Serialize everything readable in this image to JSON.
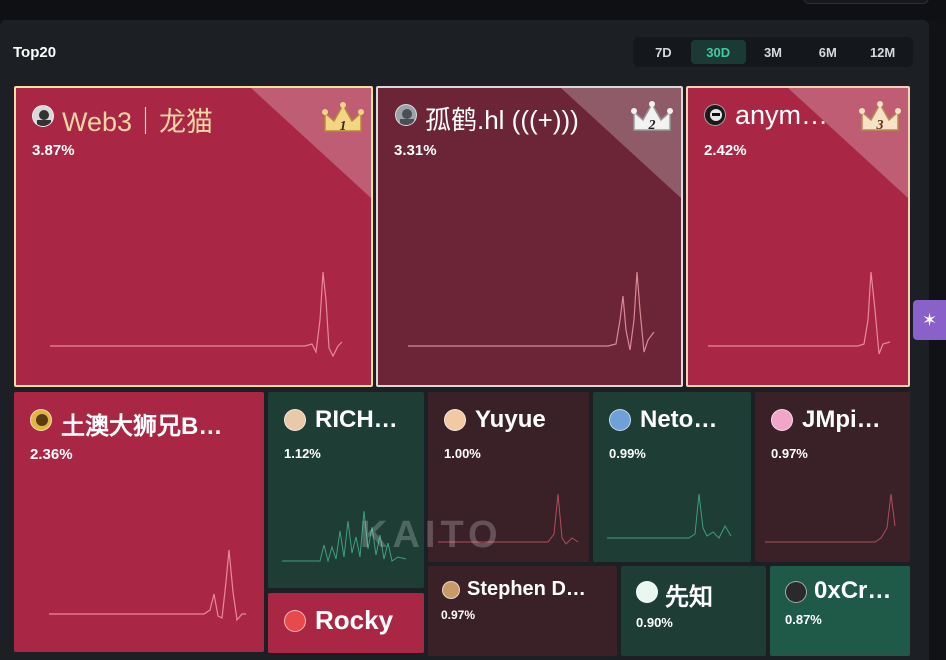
{
  "section_title": "Top20",
  "periods": [
    {
      "label": "7D",
      "active": false
    },
    {
      "label": "30D",
      "active": true
    },
    {
      "label": "3M",
      "active": false
    },
    {
      "label": "6M",
      "active": false
    },
    {
      "label": "12M",
      "active": false
    }
  ],
  "colors": {
    "red_tile": "#a92744",
    "dark_red_tile": "#6b2536",
    "maroon_tile": "#3a2128",
    "green_tile": "#1d3d35",
    "accent_green": "#3ecba4",
    "gold_border": "#f3e0a0"
  },
  "tiles": [
    {
      "rank": "1",
      "name": "Web3｜龙猫",
      "percent": "3.87%",
      "avatar_icon": "avatar-icon"
    },
    {
      "rank": "2",
      "name": "孤鹤.hl (((+)))",
      "percent": "3.31%",
      "avatar_icon": "avatar-icon"
    },
    {
      "rank": "3",
      "name": "anym…",
      "percent": "2.42%",
      "avatar_icon": "avatar-icon"
    },
    {
      "name": "土澳大狮兄B…",
      "percent": "2.36%"
    },
    {
      "name": "RICH…",
      "percent": "1.12%"
    },
    {
      "name": "Yuyue",
      "percent": "1.00%"
    },
    {
      "name": "Neto…",
      "percent": "0.99%"
    },
    {
      "name": "JMpi…",
      "percent": "0.97%"
    },
    {
      "name": "Stephen D…",
      "percent": "0.97%"
    },
    {
      "name": "先知",
      "percent": "0.90%"
    },
    {
      "name": "0xCr…",
      "percent": "0.87%"
    },
    {
      "name": "Rocky",
      "percent": ""
    }
  ],
  "watermark": "KAITO",
  "side_tab_icon": "sparkle-icon"
}
